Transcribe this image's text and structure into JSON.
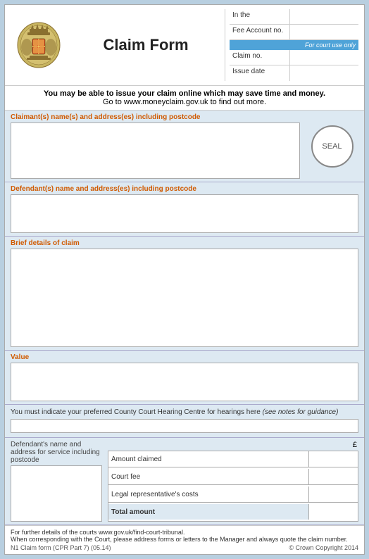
{
  "header": {
    "title": "Claim Form",
    "logo_alt": "Royal Coat of Arms",
    "seal_label": "SEAL"
  },
  "court_info": {
    "in_the_label": "In the",
    "fee_account_label": "Fee Account no.",
    "for_court_use": "For court use only",
    "claim_no_label": "Claim no.",
    "issue_date_label": "Issue date"
  },
  "notice": {
    "line1": "You may be able to issue your claim online which may save time and money.",
    "line2": "Go to www.moneyclaim.gov.uk to find out more."
  },
  "claimant": {
    "label": "Claimant(s) name(s) and address(es) including postcode"
  },
  "defendant": {
    "label": "Defendant(s) name and address(es) including postcode"
  },
  "brief_details": {
    "label": "Brief details of claim"
  },
  "value": {
    "label": "Value"
  },
  "hearing": {
    "text": "You must indicate your preferred County Court Hearing Centre for hearings here",
    "guidance": "(see notes for guidance)"
  },
  "defendant_address": {
    "label": "Defendant's name and address for service including postcode"
  },
  "amounts": {
    "pound_symbol": "£",
    "amount_claimed_label": "Amount claimed",
    "court_fee_label": "Court fee",
    "legal_rep_label": "Legal representative's costs",
    "total_label": "Total amount"
  },
  "footer": {
    "details_text": "For further details of the courts www.gov.uk/find-court-tribunal.",
    "correspondence_text": "When corresponding with the Court, please address forms or letters to the Manager and always quote the claim number.",
    "form_ref": "N1 Claim form (CPR Part 7) (05.14)",
    "copyright": "© Crown Copyright 2014"
  }
}
